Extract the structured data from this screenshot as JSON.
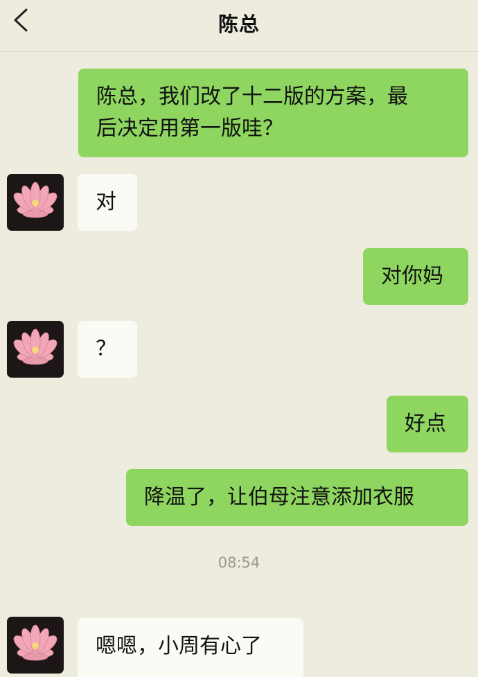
{
  "header": {
    "back_icon": "chevron-left-icon",
    "title": "陈总"
  },
  "messages": [
    {
      "side": "right",
      "text_line1": "陈总，我们改了十二版的方案，最",
      "text_line2": "后决定用第一版哇？"
    },
    {
      "side": "left",
      "text": "对"
    },
    {
      "side": "right",
      "text": "对你妈"
    },
    {
      "side": "left",
      "text": "？"
    },
    {
      "side": "right",
      "text": "好点"
    },
    {
      "side": "right",
      "text": "降温了，让伯母注意添加衣服"
    },
    {
      "side": "left",
      "text": "嗯嗯，小周有心了"
    }
  ],
  "timestamp": "08:54",
  "avatar_icon": "lotus-flower-avatar",
  "colors": {
    "background": "#eeecde",
    "sent_bubble": "#8ed660",
    "received_bubble": "#fbfbf6"
  }
}
